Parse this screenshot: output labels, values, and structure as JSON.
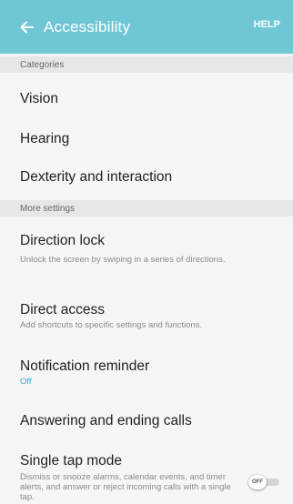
{
  "header": {
    "title": "Accessibility",
    "help_label": "HELP",
    "background": "#6fc7d5",
    "back_icon": "arrow-left-icon"
  },
  "sections": {
    "categories": "Categories",
    "more_settings": "More settings"
  },
  "categories": [
    {
      "label": "Vision"
    },
    {
      "label": "Hearing"
    },
    {
      "label": "Dexterity and interaction"
    }
  ],
  "settings": [
    {
      "label": "Direction lock",
      "description": "Unlock the screen by swiping in a series of directions."
    },
    {
      "label": "Direct access",
      "description": "Add shortcuts to specific settings and functions."
    },
    {
      "label": "Notification reminder",
      "status": "Off"
    },
    {
      "label": "Answering and ending calls"
    },
    {
      "label": "Single tap mode",
      "description": "Dismiss or snooze alarms, calendar events, and timer alerts, and answer or reject incoming calls with a single tap.",
      "toggle_text": "OFF",
      "toggle_on": false
    }
  ]
}
